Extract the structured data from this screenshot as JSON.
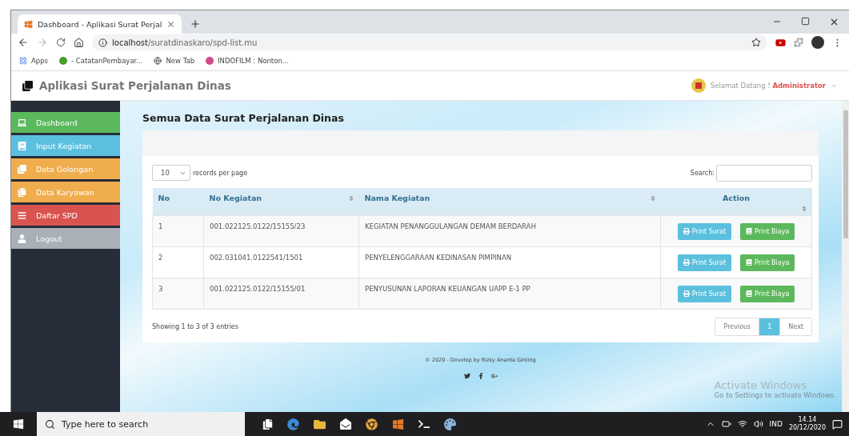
{
  "browser": {
    "tab_title": "Dashboard - Aplikasi Surat Perjal",
    "url_host": "localhost",
    "url_path": "/suratdinaskaro/spd-list.mu",
    "bookmarks": [
      "Apps",
      "- CatatanPembayar...",
      "New Tab",
      "INDOFILM : Nonton..."
    ]
  },
  "header": {
    "title": "Aplikasi Surat Perjalanan Dinas",
    "greeting": "Selamat Datang !",
    "user": "Administrator"
  },
  "sidebar": {
    "items": [
      {
        "label": "Dashboard",
        "color": "#5cb85c"
      },
      {
        "label": "Input Kegiatan",
        "color": "#5bc0de"
      },
      {
        "label": "Data Golongan",
        "color": "#f0ad4e"
      },
      {
        "label": "Data Karyawan",
        "color": "#f0ad4e"
      },
      {
        "label": "Daftar SPD",
        "color": "#d9534f"
      },
      {
        "label": "Logout",
        "color": "#aab0b8"
      }
    ]
  },
  "page_title": "Semua Data Surat Perjalanan Dinas",
  "table": {
    "length_value": "10",
    "length_label": "records per page",
    "search_label": "Search:",
    "columns": [
      {
        "label": "No",
        "sortable": false
      },
      {
        "label": "No Kegiatan",
        "sortable": true
      },
      {
        "label": "Nama Kegiatan",
        "sortable": true
      },
      {
        "label": "Action",
        "sortable": true
      }
    ],
    "rows": [
      {
        "cells": [
          "1",
          "001.022125.0122/15155/23",
          "KEGIATAN PENANGGULANGAN DEMAM BERDARAH"
        ],
        "actions": [
          "Print Surat",
          "Print Biaya"
        ]
      },
      {
        "cells": [
          "2",
          "002.031041.0122541/1501",
          "PENYELENGGARAAN KEDINASAN PIMPINAN"
        ],
        "actions": [
          "Print Surat",
          "Print Biaya"
        ]
      },
      {
        "cells": [
          "3",
          "001.022125.0122/15155/01",
          "PENYUSUNAN LAPORAN KEUANGAN UAPP E-1 PP"
        ],
        "actions": [
          "Print Surat",
          "Print Biaya"
        ]
      }
    ],
    "info": "Showing 1 to 3 of 3 entries",
    "pagination": {
      "previous": "Previous",
      "pages": [
        {
          "label": "1",
          "selected": true
        }
      ],
      "next": "Next"
    }
  },
  "footer": {
    "text": "© 2020 - Develop by Rizky Ananta Ginting"
  },
  "activation": {
    "title": "Activate Windows",
    "subtitle": "Go to Settings to activate Windows."
  },
  "taskbar": {
    "search_placeholder": "Type here to search",
    "language": "IND",
    "time": "14.14",
    "date": "20/12/2020"
  }
}
